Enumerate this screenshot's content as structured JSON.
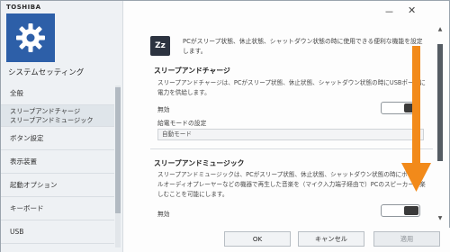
{
  "window": {
    "brand": "TOSHIBA",
    "app_title": "システムセッティング",
    "controls": {
      "minimize": "－",
      "close": "✕"
    }
  },
  "sidebar": {
    "items": [
      {
        "label": "全般"
      },
      {
        "label_line1": "スリープアンドチャージ",
        "label_line2": "スリープアンドミュージック"
      },
      {
        "label": "ボタン設定"
      },
      {
        "label": "表示装置"
      },
      {
        "label": "起動オプション"
      },
      {
        "label": "キーボード"
      },
      {
        "label": "USB"
      }
    ]
  },
  "content": {
    "icon_text": "Zz",
    "intro": "PCがスリープ状態、休止状態、シャットダウン状態の時に使用できる便利な機能を設定します。",
    "sleep_charge": {
      "title": "スリープアンドチャージ",
      "desc": "スリープアンドチャージは、PCがスリープ状態、休止状態、シャットダウン状態の時にUSBポートに電力を供給します。",
      "toggle_label": "無効",
      "power_mode_label": "給電モードの設定",
      "power_mode_value": "自動モード"
    },
    "sleep_music": {
      "title": "スリープアンドミュージック",
      "desc": "スリープアンドミュージックは、PCがスリープ状態、休止状態、シャットダウン状態の時にポータブルオーディオプレーヤーなどの機器で再生した音楽を（マイク入力端子経由で）PCのスピーカーで楽しむことを可能にします。",
      "toggle_label": "無効"
    }
  },
  "footer": {
    "ok": "OK",
    "cancel": "キャンセル",
    "apply": "適用"
  },
  "colors": {
    "accent_tile": "#2d5fa8",
    "annotation_arrow": "#f28a1a"
  }
}
